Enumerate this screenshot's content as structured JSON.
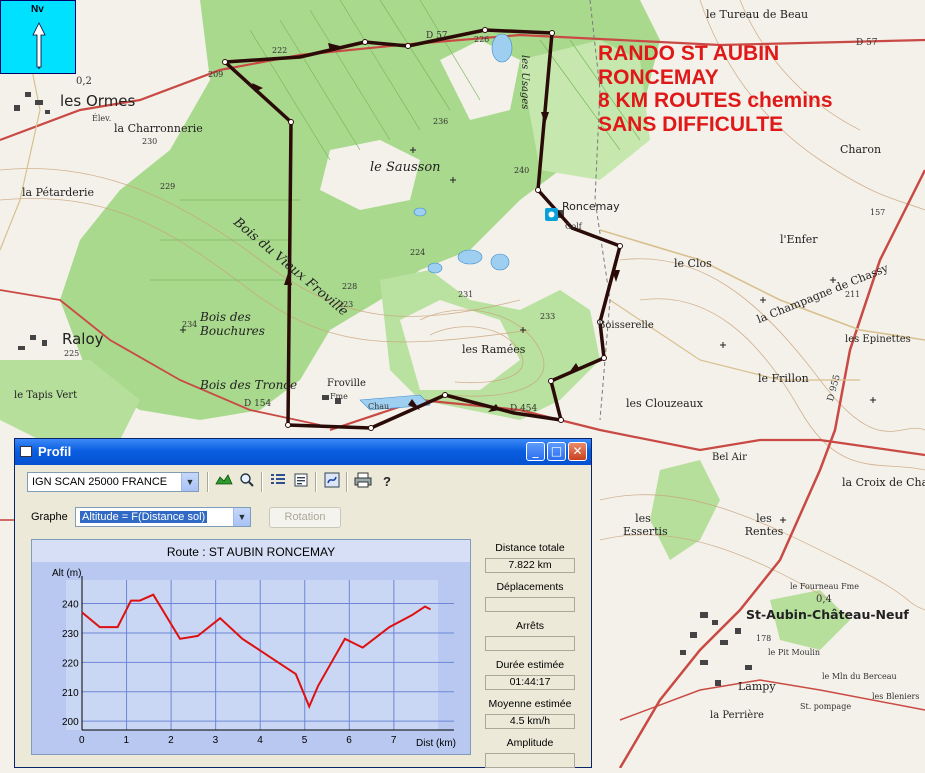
{
  "map": {
    "north_label": "Nv",
    "title_lines": [
      "RANDO ST AUBIN",
      "RONCEMAY",
      "8 KM ROUTES chemins",
      "SANS DIFFICULTE"
    ],
    "place_names": {
      "les_ormes": "les Ormes",
      "la_charronnerie": "la Charronnerie",
      "la_petarderie": "la Pétarderie",
      "raloy": "Raloy",
      "le_tapis_vert": "le Tapis Vert",
      "bois_des_bouchures": "Bois des Bouchures",
      "bois_des_tronce": "Bois des Tronce",
      "bois_du_vieux_froville": "Bois du Vieux Froville",
      "le_sausson": "le Sausson",
      "les_usages": "les Usages",
      "roncemay": "Roncemay",
      "golf": "Golf",
      "le_tureau_de_beau": "le Tureau de Beau",
      "charon": "Charon",
      "l_enfer": "l'Enfer",
      "le_clos": "le Clos",
      "la_champagne_de_chassy": "la Champagne de Chassy",
      "les_epinettes": "les Epinettes",
      "le_frillon": "le Frillon",
      "les_clouzeaux": "les Clouzeaux",
      "les_ramees": "les Ramées",
      "froville": "Froville",
      "bel_air": "Bel Air",
      "les_essertis": "les Essertis",
      "les_rentes": "les Rentes",
      "la_croix_de_cha": "la Croix de Cha",
      "le_fourneau": "le Fourneau Fme",
      "st_aubin_chateau_neuf": "St-Aubin-Château-Neuf",
      "le_pit_moulin": "le Pit Moulin",
      "lampy": "Lampy",
      "la_perriere": "la Perrière",
      "moulin_berceau": "le Mln du Berceau",
      "st_pompage": "St. pompage",
      "boisserelle": "Boisserelle",
      "fme": "Fme",
      "elev": "Élev.",
      "chau": "Chau",
      "les_bleiniers": "les Bleniers"
    },
    "road_labels": [
      "D 57",
      "D 154",
      "D 454",
      "D 955",
      "D 57"
    ],
    "elevations": [
      "222",
      "226",
      "230",
      "229",
      "236",
      "240",
      "224",
      "233",
      "234",
      "225",
      "211",
      "157",
      "178",
      "0,2",
      "0,4",
      "209",
      "228",
      "231",
      "223"
    ]
  },
  "window": {
    "title": "Profil",
    "controls": {
      "minimize": "_",
      "maximize": "□",
      "close": "✕"
    },
    "toolbar": {
      "map_source": "IGN SCAN 25000 FRANCE",
      "icons": [
        "profile-icon",
        "zoom-icon",
        "list-icon",
        "properties-icon",
        "settings-icon",
        "print-icon",
        "help-icon"
      ]
    },
    "graph_label": "Graphe",
    "graph_select": "Altitude = F(Distance sol)",
    "rotation_button": "Rotation",
    "stats": [
      {
        "label": "Distance totale",
        "value": "7.822 km"
      },
      {
        "label": "Déplacements",
        "value": ""
      },
      {
        "label": "Arrêts",
        "value": ""
      },
      {
        "label": "Durée estimée",
        "value": "01:44:17"
      },
      {
        "label": "Moyenne estimée",
        "value": "4.5 km/h"
      },
      {
        "label": "Amplitude",
        "value": ""
      }
    ]
  },
  "chart_data": {
    "type": "line",
    "title": "Route : ST AUBIN RONCEMAY",
    "xlabel": "Dist (km)",
    "ylabel": "Alt (m)",
    "xlim": [
      0,
      7.822
    ],
    "ylim": [
      200,
      245
    ],
    "xticks": [
      0,
      1,
      2,
      3,
      4,
      5,
      6,
      7
    ],
    "yticks": [
      200,
      210,
      220,
      230,
      240
    ],
    "grid": true,
    "color": "#dd1111",
    "x": [
      0,
      0.4,
      0.8,
      1.1,
      1.3,
      1.6,
      2.2,
      2.6,
      3.1,
      3.6,
      4.3,
      4.8,
      5.1,
      5.3,
      5.9,
      6.3,
      6.9,
      7.4,
      7.7,
      7.822
    ],
    "y": [
      237,
      232,
      232,
      241,
      241,
      243,
      228,
      229,
      235,
      228,
      221,
      216,
      205,
      212,
      228,
      225,
      232,
      236,
      239,
      238
    ]
  }
}
